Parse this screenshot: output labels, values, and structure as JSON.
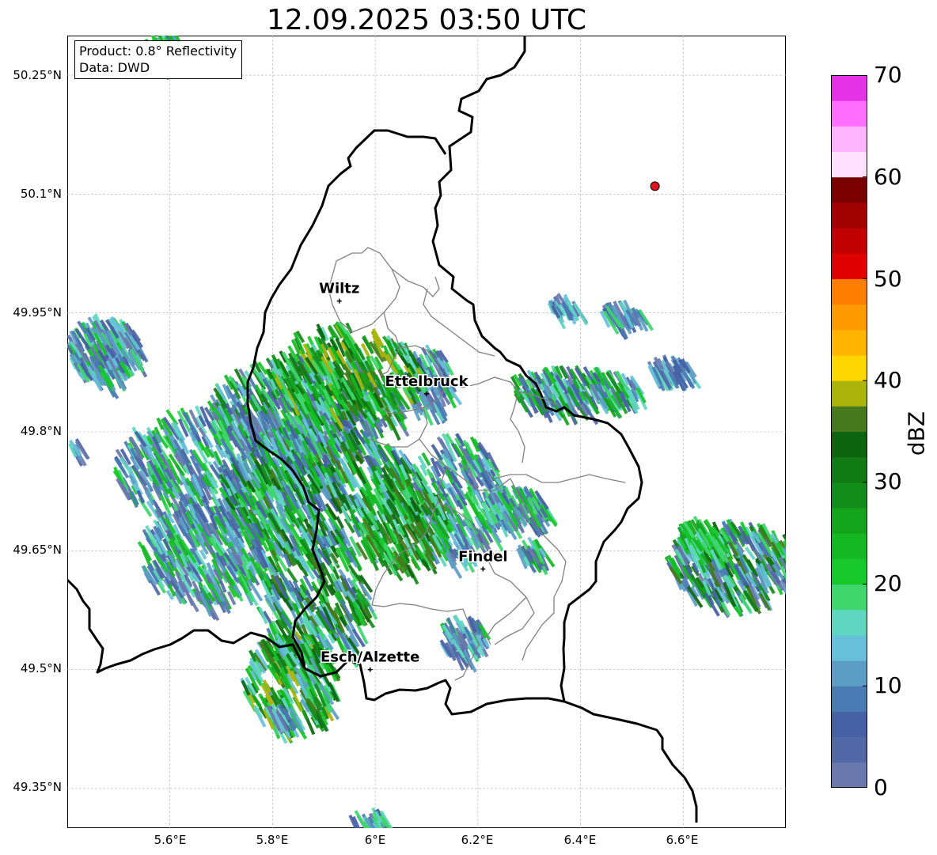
{
  "title": "12.09.2025 03:50 UTC",
  "info": {
    "product": "Product: 0.8° Reflectivity",
    "source": "Data: DWD"
  },
  "lat_ticks": [
    "50.25°N",
    "50.1°N",
    "49.95°N",
    "49.8°N",
    "49.65°N",
    "49.5°N",
    "49.35°N"
  ],
  "lon_ticks": [
    "5.6°E",
    "5.8°E",
    "6°E",
    "6.2°E",
    "6.4°E",
    "6.6°E"
  ],
  "extent": {
    "lon_min": 5.4,
    "lon_max": 6.8,
    "lat_min": 49.3,
    "lat_max": 50.3
  },
  "grid": true,
  "cities": [
    {
      "name": "Wiltz",
      "lon": 5.93,
      "lat": 49.965
    },
    {
      "name": "Ettelbruck",
      "lon": 6.1,
      "lat": 49.848
    },
    {
      "name": "Findel",
      "lon": 6.21,
      "lat": 49.627
    },
    {
      "name": "Esch/Alzette",
      "lon": 5.99,
      "lat": 49.5
    }
  ],
  "radar_site_marker": {
    "lon": 6.545,
    "lat": 50.11,
    "color": "#e0141e"
  },
  "colorbar": {
    "label": "dBZ",
    "ticks": [
      "0",
      "10",
      "20",
      "30",
      "40",
      "50",
      "60",
      "70"
    ],
    "min": 0,
    "max": 70,
    "colors": [
      "#6a78ad",
      "#5268a6",
      "#4560a4",
      "#4a7ab4",
      "#5c9dc6",
      "#66c0da",
      "#5fd6c0",
      "#3fd66e",
      "#16c82a",
      "#14b822",
      "#14a41c",
      "#128c18",
      "#107a12",
      "#0c6410",
      "#46781c",
      "#aab40a",
      "#ffd700",
      "#ffb400",
      "#ff9900",
      "#ff7d00",
      "#e00000",
      "#c00000",
      "#a00000",
      "#7a0000",
      "#ffe0ff",
      "#ffb4ff",
      "#ff6eff",
      "#e632e6"
    ]
  }
}
